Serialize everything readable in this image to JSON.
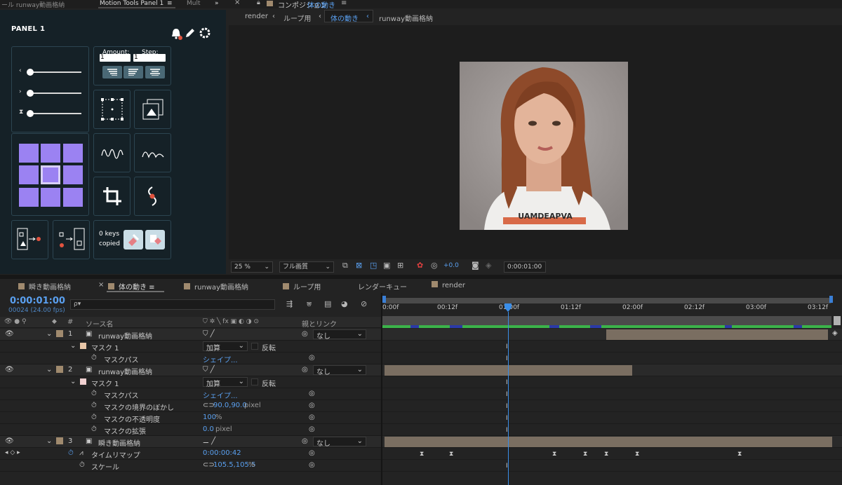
{
  "motion_tools": {
    "tab_prev": "ール runway動画格納",
    "tab_active": "Motion Tools Panel 1",
    "tab_next": "Mult",
    "panel_title": "PANEL 1",
    "amount_label": "Amount:",
    "amount_value": "1",
    "step_label": "Step:",
    "step_value": "1",
    "keys_copied_1": "0 keys",
    "keys_copied_2": "copied"
  },
  "composition": {
    "tab_title": "コンポジション",
    "tab_comp_name": "体の動き",
    "breadcrumb": [
      "render",
      "ループ用",
      "体の動き",
      "runway動画格納"
    ],
    "zoom": "25 %",
    "quality": "フル画質",
    "exposure": "+0.0",
    "timecode": "0:00:01:00",
    "shirt_text": "UAMDEAPVA"
  },
  "timeline": {
    "tabs": [
      "瞬き動画格納",
      "体の動き",
      "runway動画格納",
      "ループ用",
      "レンダーキュー",
      "render"
    ],
    "current_time": "0:00:01:00",
    "frame_info": "00024 (24.00 fps)",
    "search_placeholder": "ρ▾",
    "col_hash": "#",
    "col_source": "ソース名",
    "col_parent": "親とリンク",
    "ruler": [
      "0:00f",
      "00:12f",
      "01:00f",
      "01:12f",
      "02:00f",
      "02:12f",
      "03:00f",
      "03:12f"
    ],
    "rows": [
      {
        "num": "1",
        "name": "runway動画格納",
        "parent": "なし"
      },
      {
        "name": "マスク 1",
        "mode": "加算",
        "invert": "反転"
      },
      {
        "name": "マスクパス",
        "value": "シェイプ..."
      },
      {
        "num": "2",
        "name": "runway動画格納",
        "parent": "なし"
      },
      {
        "name": "マスク 1",
        "mode": "加算",
        "invert": "反転"
      },
      {
        "name": "マスクパス",
        "value": "シェイプ..."
      },
      {
        "name": "マスクの境界のぼかし",
        "value": "90.0,90.0",
        "unit": "pixel"
      },
      {
        "name": "マスクの不透明度",
        "value": "100",
        "unit": "%"
      },
      {
        "name": "マスクの拡張",
        "value": "0.0",
        "unit": "pixel"
      },
      {
        "num": "3",
        "name": "瞬き動画格納",
        "parent": "なし"
      },
      {
        "name": "タイムリマップ",
        "value": "0:00:00:42"
      },
      {
        "name": "スケール",
        "value": "105.5,105.5",
        "unit": "%"
      }
    ]
  },
  "colors": {
    "accent_blue": "#2d8ceb",
    "layer_bar": "#7a6e61",
    "grid_purple": "#9b82f2",
    "panel_bg": "#152127"
  }
}
